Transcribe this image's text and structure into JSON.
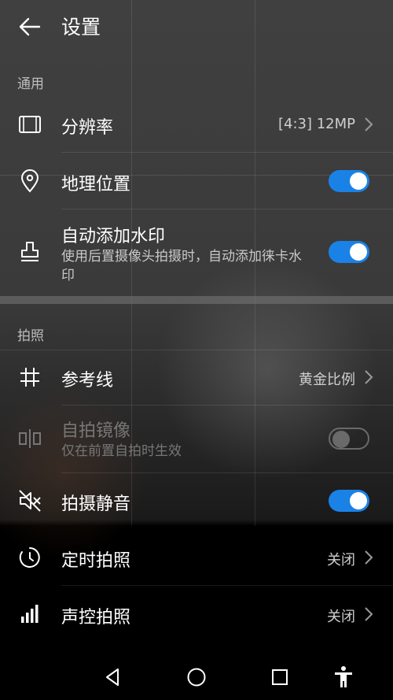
{
  "header": {
    "title": "设置"
  },
  "sections": {
    "general": "通用",
    "photo": "拍照"
  },
  "rows": {
    "resolution": {
      "label": "分辨率",
      "value": "[4:3] 12MP"
    },
    "location": {
      "label": "地理位置",
      "toggle": true
    },
    "watermark": {
      "label": "自动添加水印",
      "sub": "使用后置摄像头拍摄时，自动添加徕卡水印",
      "toggle": true
    },
    "gridlines": {
      "label": "参考线",
      "value": "黄金比例"
    },
    "mirror": {
      "label": "自拍镜像",
      "sub": "仅在前置自拍时生效",
      "toggle": false,
      "disabled": true
    },
    "mute": {
      "label": "拍摄静音",
      "toggle": true
    },
    "timer": {
      "label": "定时拍照",
      "value": "关闭"
    },
    "voice": {
      "label": "声控拍照",
      "value": "关闭"
    }
  },
  "colors": {
    "accent": "#1a82e6"
  }
}
